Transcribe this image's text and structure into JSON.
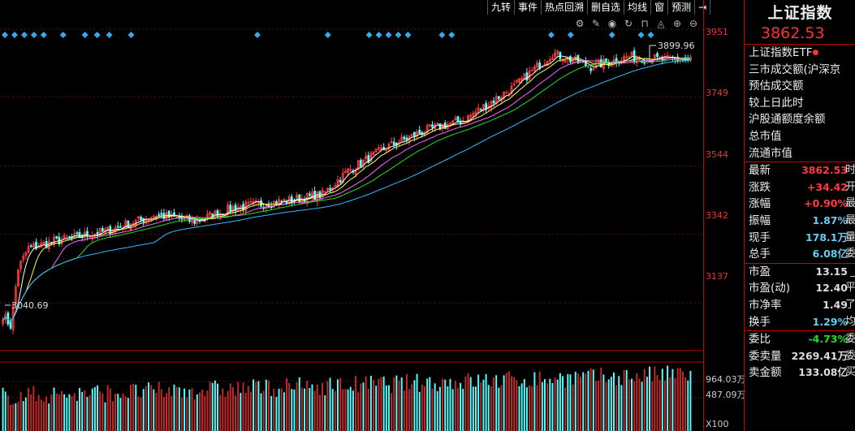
{
  "toolbar": {
    "buttons": [
      "九转",
      "事件",
      "热点回溯",
      "删自选",
      "均线",
      "窗",
      "预测"
    ],
    "end_icon": "⇥"
  },
  "axis": {
    "price_ticks": [
      "3951",
      "3749",
      "3544",
      "3342",
      "3137"
    ],
    "volume_ticks": [
      "964.03万",
      "487.09万"
    ],
    "volume_unit": "X100"
  },
  "chart_labels": {
    "high_label": "3899.96",
    "low_label": "3040.69"
  },
  "panel": {
    "title": "上证指数",
    "price": "3862.53",
    "etf_label": "上证指数ETF",
    "text_rows": [
      "三市成交额(沪深京",
      "预估成交额",
      "较上日此时",
      "沪股通额度余额",
      "总市值",
      "流通市值"
    ],
    "stats": [
      {
        "label": "最新",
        "value": "3862.53",
        "tail": "时",
        "color": "red"
      },
      {
        "label": "涨跌",
        "value": "+34.42",
        "tail": "开",
        "color": "red"
      },
      {
        "label": "涨幅",
        "value": "+0.90%",
        "tail": "最",
        "color": "red"
      },
      {
        "label": "振幅",
        "value": "1.87%",
        "tail": "最",
        "color": "cyan"
      },
      {
        "label": "现手",
        "value": "178.1万",
        "tail": "量",
        "color": "cyan"
      },
      {
        "label": "总手",
        "value": "6.08亿",
        "tail": "委",
        "color": "cyan"
      }
    ],
    "valuation": [
      {
        "label": "市盈",
        "value": "13.15",
        "tail": "_",
        "color": "gray"
      },
      {
        "label": "市盈(动)",
        "value": "12.40",
        "tail": "平",
        "color": "gray"
      },
      {
        "label": "市净率",
        "value": "1.49",
        "tail": "了",
        "color": "gray"
      },
      {
        "label": "换手",
        "value": "1.29%",
        "tail": "均",
        "color": "cyan"
      }
    ],
    "orders": [
      {
        "label": "委比",
        "value": "-4.73%",
        "tail": "委",
        "color": "green"
      },
      {
        "label": "委卖量",
        "value": "2269.41万",
        "tail": "委",
        "color": "gray"
      },
      {
        "label": "卖金额",
        "value": "133.08亿",
        "tail": "买",
        "color": "gray"
      }
    ]
  },
  "colors": {
    "up": "#ff3b3b",
    "down": "#54ffff",
    "ma5": "#ffffff",
    "ma10": "#ffff55",
    "ma20": "#ff66ff",
    "ma30": "#22dd22",
    "ma60": "#33bbff",
    "marker": "#33aaee",
    "frame": "#cc0000"
  },
  "chart_data": {
    "type": "candlestick",
    "y_range": [
      3040.69,
      3951
    ],
    "anchors": [
      [
        0,
        3100
      ],
      [
        3,
        3070
      ],
      [
        6,
        3240
      ],
      [
        10,
        3300
      ],
      [
        20,
        3320
      ],
      [
        40,
        3350
      ],
      [
        60,
        3400
      ],
      [
        75,
        3380
      ],
      [
        90,
        3420
      ],
      [
        110,
        3440
      ],
      [
        125,
        3460
      ],
      [
        135,
        3530
      ],
      [
        150,
        3600
      ],
      [
        165,
        3650
      ],
      [
        180,
        3680
      ],
      [
        200,
        3780
      ],
      [
        215,
        3880
      ],
      [
        230,
        3840
      ],
      [
        245,
        3870
      ],
      [
        260,
        3860
      ],
      [
        270,
        3862.53
      ]
    ],
    "count": 270
  }
}
